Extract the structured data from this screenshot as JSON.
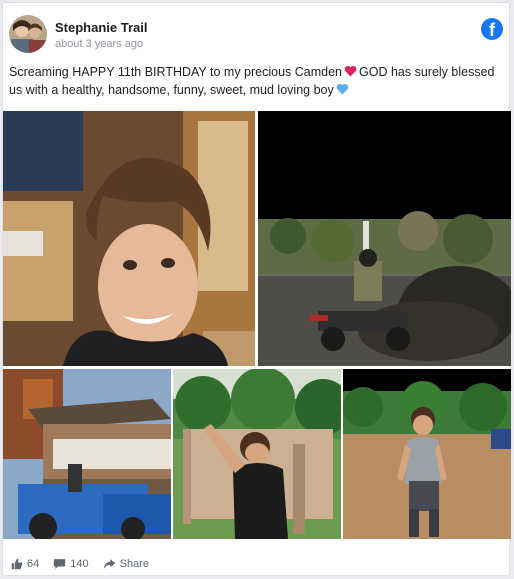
{
  "post": {
    "author_name": "Stephanie Trail",
    "timestamp": "about 3 years ago",
    "text_part1": "Screaming HAPPY 11th BIRTHDAY to my precious Camden",
    "text_part2": "GOD has surely blessed us with a healthy, handsome, funny, sweet, mud loving boy",
    "platform_icon": "facebook-icon"
  },
  "footer": {
    "likes": "64",
    "comments": "140",
    "share_label": "Share"
  },
  "photos": [
    {
      "name": "boy-portrait-photo"
    },
    {
      "name": "atv-mud-photo"
    },
    {
      "name": "tractor-porch-photo"
    },
    {
      "name": "boy-fence-photo"
    },
    {
      "name": "boy-field-photo"
    }
  ],
  "colors": {
    "facebook_blue": "#1877f2",
    "heart_red": "#e0245e",
    "heart_blue": "#5dadec"
  }
}
